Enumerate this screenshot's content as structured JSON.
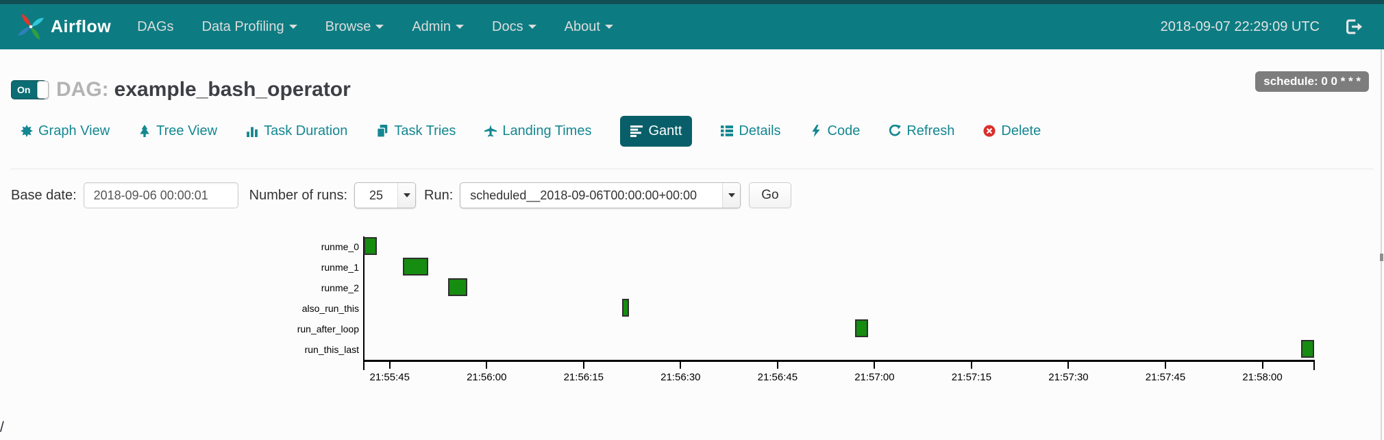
{
  "navbar": {
    "brand": "Airflow",
    "logo_icon": "airflow-pinwheel-logo",
    "items": [
      {
        "label": "DAGs",
        "caret": false
      },
      {
        "label": "Data Profiling",
        "caret": true
      },
      {
        "label": "Browse",
        "caret": true
      },
      {
        "label": "Admin",
        "caret": true
      },
      {
        "label": "Docs",
        "caret": true
      },
      {
        "label": "About",
        "caret": true
      }
    ],
    "clock": "2018-09-07 22:29:09 UTC",
    "logout_icon": "sign-out-icon"
  },
  "dag_header": {
    "toggle_label": "On",
    "prefix": "DAG:",
    "dag_name": "example_bash_operator",
    "schedule_badge": "schedule: 0 0 * * *"
  },
  "tabs": [
    {
      "label": "Graph View",
      "icon": "burst-icon",
      "active": false
    },
    {
      "label": "Tree View",
      "icon": "tree-icon",
      "active": false
    },
    {
      "label": "Task Duration",
      "icon": "bar-chart-icon",
      "active": false
    },
    {
      "label": "Task Tries",
      "icon": "copy-icon",
      "active": false
    },
    {
      "label": "Landing Times",
      "icon": "plane-icon",
      "active": false
    },
    {
      "label": "Gantt",
      "icon": "align-left-icon",
      "active": true
    },
    {
      "label": "Details",
      "icon": "list-icon",
      "active": false
    },
    {
      "label": "Code",
      "icon": "bolt-icon",
      "active": false
    },
    {
      "label": "Refresh",
      "icon": "refresh-icon",
      "active": false
    },
    {
      "label": "Delete",
      "icon": "delete-circle-x-icon",
      "active": false
    }
  ],
  "filter_form": {
    "base_date_label": "Base date:",
    "base_date_value": "2018-09-06 00:00:01",
    "num_runs_label": "Number of runs:",
    "num_runs_value": "25",
    "run_label": "Run:",
    "run_value": "scheduled__2018-09-06T00:00:00+00:00",
    "go_label": "Go"
  },
  "chart_data": {
    "type": "gantt",
    "title": "",
    "tasks": [
      {
        "name": "runme_0",
        "start": "21:55:41",
        "end": "21:55:43"
      },
      {
        "name": "runme_1",
        "start": "21:55:47",
        "end": "21:55:51"
      },
      {
        "name": "runme_2",
        "start": "21:55:54",
        "end": "21:55:57"
      },
      {
        "name": "also_run_this",
        "start": "21:56:21",
        "end": "21:56:22"
      },
      {
        "name": "run_after_loop",
        "start": "21:56:57",
        "end": "21:56:59"
      },
      {
        "name": "run_this_last",
        "start": "21:58:06",
        "end": "21:58:08"
      }
    ],
    "x_ticks": [
      "21:55:45",
      "21:56:00",
      "21:56:15",
      "21:56:30",
      "21:56:45",
      "21:57:00",
      "21:57:15",
      "21:57:30",
      "21:57:45",
      "21:58:00"
    ],
    "axis_start": "21:55:41",
    "axis_end": "21:58:08",
    "bar_color": "#168c10",
    "bar_border": "#2f2f2f",
    "grid": false,
    "legend": false
  },
  "status_bar": {
    "text": "/"
  },
  "colors": {
    "navbar_teal": "#0d7c82",
    "link_teal": "#148791",
    "active_tab_bg": "#095f69",
    "delete_red": "#d9302c",
    "badge_gray": "#7d7d7d",
    "bar_green": "#168c10"
  }
}
